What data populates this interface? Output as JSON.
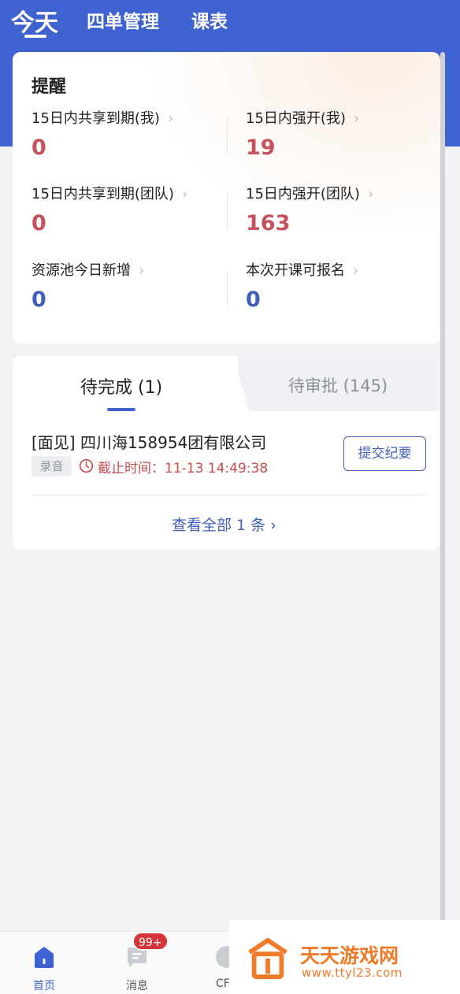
{
  "top_nav": {
    "tabs": [
      {
        "label": "今天",
        "active": true
      },
      {
        "label": "四单管理",
        "active": false
      },
      {
        "label": "课表",
        "active": false
      }
    ]
  },
  "reminders": {
    "title": "提醒",
    "items": [
      {
        "label": "15日内共享到期(我)",
        "value": "0",
        "color": "#c6505b"
      },
      {
        "label": "15日内强开(我)",
        "value": "19",
        "color": "#c6505b"
      },
      {
        "label": "15日内共享到期(团队)",
        "value": "0",
        "color": "#c6505b"
      },
      {
        "label": "15日内强开(团队)",
        "value": "163",
        "color": "#c6505b"
      },
      {
        "label": "资源池今日新增",
        "value": "0",
        "color": "#3f5fb8"
      },
      {
        "label": "本次开课可报名",
        "value": "0",
        "color": "#3f5fb8"
      }
    ]
  },
  "tasks": {
    "tabs": [
      {
        "label": "待完成 (1)",
        "active": true
      },
      {
        "label": "待审批 (145)",
        "active": false
      }
    ],
    "item": {
      "title": "[面见] 四川海158954团有限公司",
      "tag": "录音",
      "deadline": "截止时间：11-13 14:49:38",
      "action": "提交纪要"
    },
    "view_all": "查看全部 1 条 ›"
  },
  "bottom_nav": {
    "items": [
      {
        "label": "首页",
        "icon": "home-icon",
        "active": true
      },
      {
        "label": "消息",
        "icon": "message-icon",
        "active": false,
        "badge": "99+"
      },
      {
        "label": "CF",
        "icon": "cf-icon",
        "active": false
      }
    ]
  },
  "watermark": {
    "title": "天天游戏网",
    "url": "www.ttyl23.com"
  },
  "colors": {
    "primary": "#3e63d0",
    "danger": "#c6505b",
    "accent_orange": "#f07a28"
  }
}
